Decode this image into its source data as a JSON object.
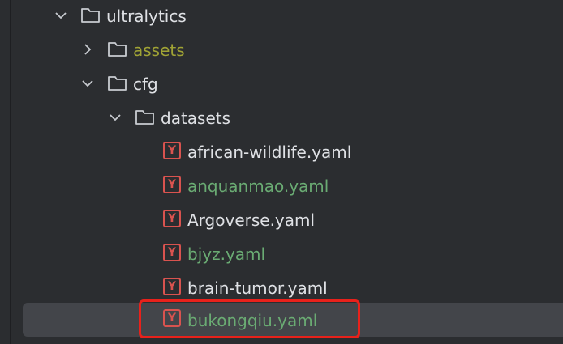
{
  "tree": {
    "rows": [
      {
        "label": "ultralytics",
        "kind": "folder",
        "expanded": true
      },
      {
        "label": "assets",
        "kind": "folder",
        "expanded": false,
        "color": "#a0a335"
      },
      {
        "label": "cfg",
        "kind": "folder",
        "expanded": true
      },
      {
        "label": "datasets",
        "kind": "folder",
        "expanded": true
      },
      {
        "label": "african-wildlife.yaml",
        "kind": "yaml",
        "icon_letter": "Y"
      },
      {
        "label": "anquanmao.yaml",
        "kind": "yaml",
        "icon_letter": "Y",
        "color": "#6aab73"
      },
      {
        "label": "Argoverse.yaml",
        "kind": "yaml",
        "icon_letter": "Y"
      },
      {
        "label": "bjyz.yaml",
        "kind": "yaml",
        "icon_letter": "Y",
        "color": "#6aab73"
      },
      {
        "label": "brain-tumor.yaml",
        "kind": "yaml",
        "icon_letter": "Y"
      },
      {
        "label": "bukongqiu.yaml",
        "kind": "yaml",
        "icon_letter": "Y",
        "color": "#6aab73",
        "selected": true
      }
    ]
  },
  "colors": {
    "background": "#2b2d30",
    "selection": "#43454a",
    "highlight_box": "#e8211b",
    "yaml_icon": "#d9534f",
    "default_text": "#dfe1e5"
  },
  "icons": {
    "chevron_down": "chevron-down-icon",
    "chevron_right": "chevron-right-icon",
    "folder": "folder-icon",
    "yaml": "yaml-file-icon"
  }
}
